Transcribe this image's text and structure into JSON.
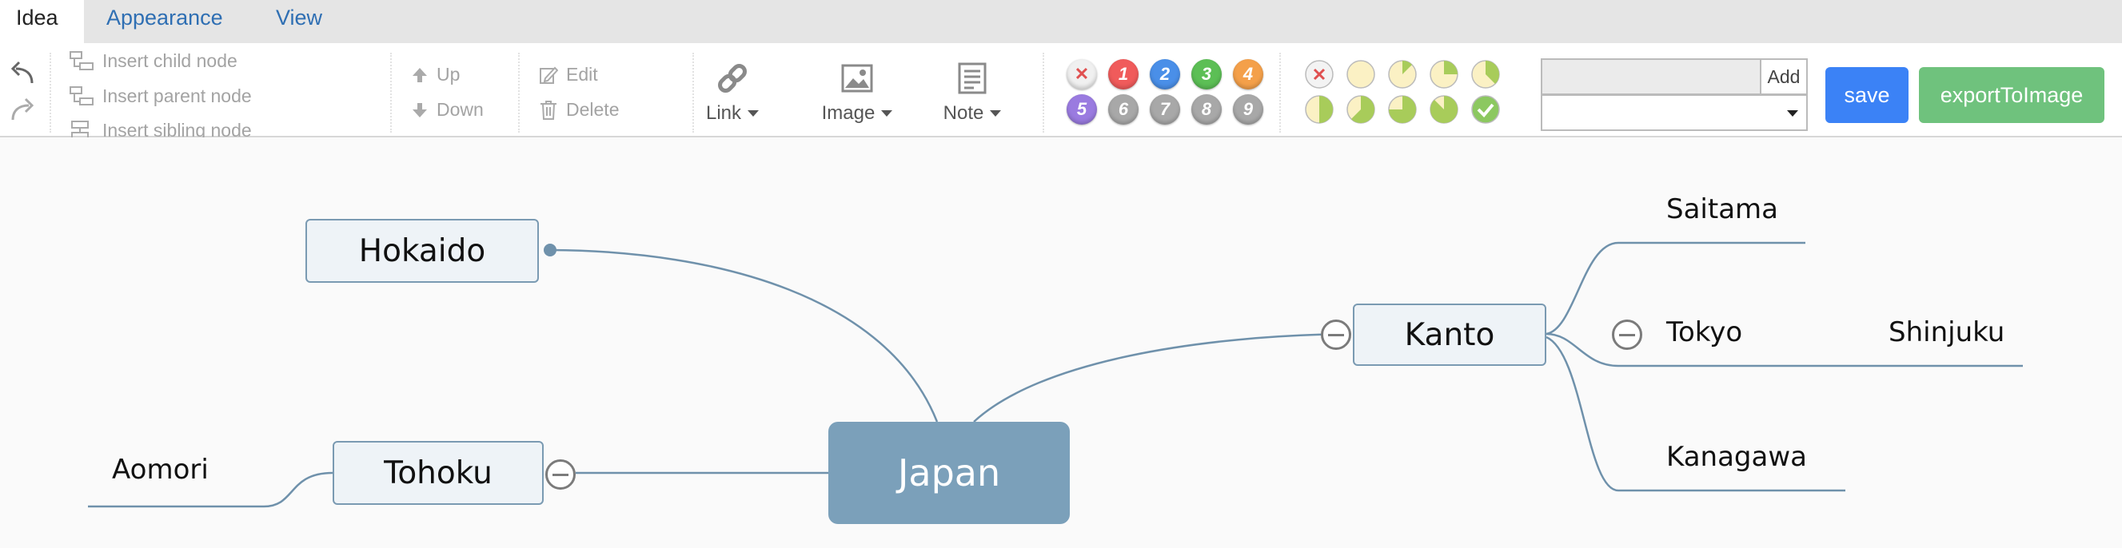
{
  "tabs": [
    {
      "label": "Idea",
      "active": true
    },
    {
      "label": "Appearance",
      "active": false
    },
    {
      "label": "View",
      "active": false
    }
  ],
  "toolbar": {
    "history": {
      "undo_icon": "undo-icon",
      "redo_icon": "redo-icon"
    },
    "insert": {
      "child": "Insert child node",
      "parent": "Insert parent node",
      "sibling": "Insert sibling node"
    },
    "arrange": {
      "up": "Up",
      "down": "Down"
    },
    "edit": {
      "edit": "Edit",
      "delete": "Delete"
    },
    "link": "Link",
    "image": "Image",
    "note": "Note",
    "priority": [
      {
        "label": "",
        "color": "#f0f0f0",
        "icon": "remove-icon"
      },
      {
        "label": "1",
        "color": "#f05b5b"
      },
      {
        "label": "2",
        "color": "#4a8fe8"
      },
      {
        "label": "3",
        "color": "#5cbf55"
      },
      {
        "label": "4",
        "color": "#f4a04a"
      },
      {
        "label": "5",
        "color": "#9a7be0"
      },
      {
        "label": "6",
        "color": "#a8a8a8"
      },
      {
        "label": "7",
        "color": "#a8a8a8"
      },
      {
        "label": "8",
        "color": "#a8a8a8"
      },
      {
        "label": "9",
        "color": "#a8a8a8"
      }
    ],
    "progress": [
      {
        "icon": "remove-icon",
        "fraction": null
      },
      {
        "icon": "progress-0-icon",
        "fraction": 0
      },
      {
        "icon": "progress-1-icon",
        "fraction": 0.125
      },
      {
        "icon": "progress-2-icon",
        "fraction": 0.25
      },
      {
        "icon": "progress-3-icon",
        "fraction": 0.375
      },
      {
        "icon": "progress-4-icon",
        "fraction": 0.5
      },
      {
        "icon": "progress-5-icon",
        "fraction": 0.625
      },
      {
        "icon": "progress-6-icon",
        "fraction": 0.75
      },
      {
        "icon": "progress-7-icon",
        "fraction": 0.875
      },
      {
        "icon": "progress-done-icon",
        "fraction": 1
      }
    ],
    "hyperlink": {
      "input_value": "",
      "add_label": "Add",
      "select_value": ""
    },
    "save_label": "save",
    "export_label": "exportToImage"
  },
  "mindmap": {
    "root": "Japan",
    "nodes": {
      "hokaido": "Hokaido",
      "tohoku": "Tohoku",
      "aomori": "Aomori",
      "kanto": "Kanto",
      "saitama": "Saitama",
      "tokyo": "Tokyo",
      "shinjuku": "Shinjuku",
      "kanagawa": "Kanagawa"
    },
    "colors": {
      "line": "#6f91ab",
      "root": "#7ba0ba",
      "node_border": "#7a9ab2",
      "node_bg": "#eef3f7"
    }
  }
}
